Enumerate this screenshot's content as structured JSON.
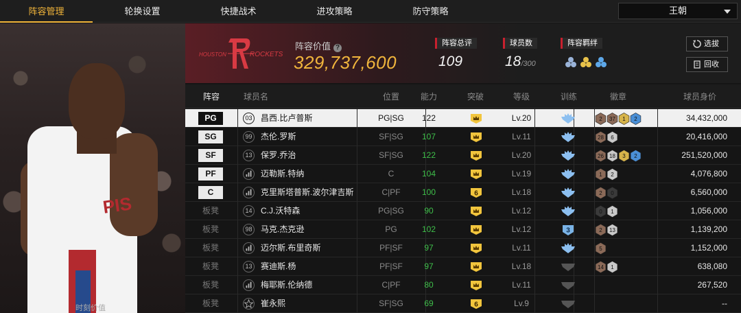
{
  "tabs": [
    {
      "label": "阵容管理",
      "active": true
    },
    {
      "label": "轮换设置",
      "active": false
    },
    {
      "label": "快捷战术",
      "active": false
    },
    {
      "label": "进攻策略",
      "active": false
    },
    {
      "label": "防守策略",
      "active": false
    }
  ],
  "team_select": {
    "value": "王朝"
  },
  "photo_caption": "时刻价值",
  "header": {
    "logo_text_left": "HOUSTON",
    "logo_text_right": "ROCKETS",
    "value_label": "阵容价值",
    "value_help": "?",
    "value": "329,737,600",
    "overall_label": "阵容总评",
    "overall": "109",
    "players_label": "球员数",
    "players": "18",
    "players_max": "/300",
    "bonds_label": "阵容羁绊",
    "btn_pick": "选拔",
    "btn_recycle": "回收"
  },
  "columns": [
    "阵容",
    "球员名",
    "位置",
    "能力",
    "突破",
    "等级",
    "训练",
    "徽章",
    "球员身价"
  ],
  "rows": [
    {
      "slot": "PG",
      "starter": true,
      "num": "03",
      "name": "昌西.比卢普斯",
      "pos": "PG|SG",
      "ability": "122",
      "breakthrough": "crown",
      "level": "Lv.20",
      "train": "gem",
      "badges": [
        [
          "2",
          "bronze"
        ],
        [
          "37",
          "bronze"
        ],
        [
          "1",
          "gold"
        ],
        [
          "2",
          "blue"
        ]
      ],
      "value": "34,432,000"
    },
    {
      "slot": "SG",
      "starter": true,
      "num": "99",
      "name": "杰伦.罗斯",
      "pos": "SF|SG",
      "ability": "107",
      "breakthrough": "crown",
      "level": "Lv.11",
      "train": "gem",
      "badges": [
        [
          "28",
          "bronze"
        ],
        [
          "6",
          "silver"
        ]
      ],
      "value": "20,416,000"
    },
    {
      "slot": "SF",
      "starter": true,
      "num": "13",
      "name": "保罗.乔治",
      "pos": "SF|SG",
      "ability": "122",
      "breakthrough": "crown",
      "level": "Lv.20",
      "train": "gem",
      "badges": [
        [
          "26",
          "bronze"
        ],
        [
          "18",
          "silver"
        ],
        [
          "3",
          "gold"
        ],
        [
          "2",
          "blue"
        ]
      ],
      "value": "251,520,000"
    },
    {
      "slot": "PF",
      "starter": true,
      "num": "bars",
      "name": "迈勒斯.特纳",
      "pos": "C",
      "ability": "104",
      "breakthrough": "crown",
      "level": "Lv.19",
      "train": "gem",
      "badges": [
        [
          "1",
          "bronze"
        ],
        [
          "2",
          "silver"
        ]
      ],
      "value": "4,076,800"
    },
    {
      "slot": "C",
      "starter": true,
      "num": "bars",
      "name": "克里斯塔普斯.波尔津吉斯",
      "pos": "C|PF",
      "ability": "100",
      "breakthrough": "6",
      "level": "Lv.18",
      "train": "gem",
      "badges": [
        [
          "2",
          "bronze"
        ],
        [
          "0",
          "dark"
        ]
      ],
      "value": "6,560,000"
    },
    {
      "slot": "板凳",
      "starter": false,
      "num": "14",
      "name": "C.J.沃特森",
      "pos": "PG|SG",
      "ability": "90",
      "breakthrough": "crown",
      "level": "Lv.12",
      "train": "gem",
      "badges": [
        [
          "0",
          "dark"
        ],
        [
          "1",
          "silver"
        ]
      ],
      "value": "1,056,000"
    },
    {
      "slot": "板凳",
      "starter": false,
      "num": "98",
      "name": "马克.杰克逊",
      "pos": "PG",
      "ability": "102",
      "breakthrough": "crown",
      "level": "Lv.12",
      "train": "3",
      "badges": [
        [
          "2",
          "bronze"
        ],
        [
          "13",
          "silver"
        ]
      ],
      "value": "1,139,200"
    },
    {
      "slot": "板凳",
      "starter": false,
      "num": "bars",
      "name": "迈尔斯.布里奇斯",
      "pos": "PF|SF",
      "ability": "97",
      "breakthrough": "crown",
      "level": "Lv.11",
      "train": "gem",
      "badges": [
        [
          "5",
          "bronze"
        ]
      ],
      "value": "1,152,000"
    },
    {
      "slot": "板凳",
      "starter": false,
      "num": "13",
      "name": "赛迪斯.杨",
      "pos": "PF|SF",
      "ability": "97",
      "breakthrough": "crown",
      "level": "Lv.18",
      "train": "grey",
      "badges": [
        [
          "14",
          "bronze"
        ],
        [
          "1",
          "silver"
        ]
      ],
      "value": "638,080"
    },
    {
      "slot": "板凳",
      "starter": false,
      "num": "bars",
      "name": "梅耶斯.伦纳德",
      "pos": "C|PF",
      "ability": "80",
      "breakthrough": "crown",
      "level": "Lv.11",
      "train": "grey",
      "badges": [],
      "value": "267,520"
    },
    {
      "slot": "板凳",
      "starter": false,
      "num": "star",
      "name": "崔永熙",
      "pos": "SF|SG",
      "ability": "69",
      "breakthrough": "6",
      "level": "Lv.9",
      "train": "grey",
      "badges": [],
      "value": "--"
    }
  ]
}
